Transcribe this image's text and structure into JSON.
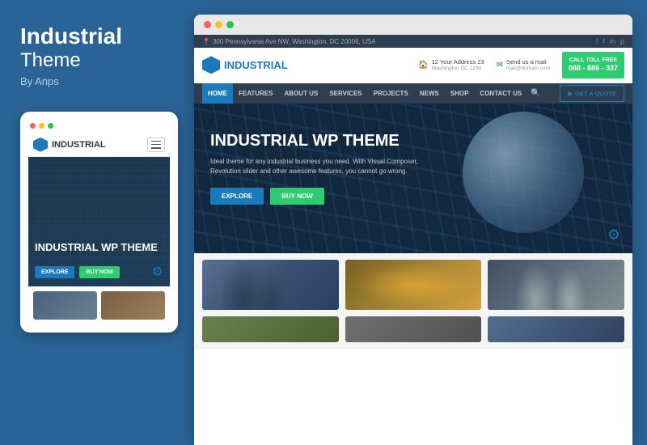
{
  "left": {
    "brand_title": "Industrial",
    "brand_sub": "Theme",
    "by_author": "By Anps"
  },
  "mobile": {
    "dots": [
      "red",
      "yellow",
      "green"
    ],
    "logo_text": "INDUSTRIAL",
    "hero_title": "INDUSTRIAL WP\nTHEME",
    "btn_explore": "EXPLORE",
    "btn_buynow": "BUY NOW"
  },
  "site": {
    "topbar_address": "300 Pennsylvania Ave NW, Washington, DC 20006, USA",
    "logo_text": "INDUSTRIAL",
    "address_label": "12 Your Address 23",
    "address_sub": "Washington DC 1234",
    "email_label": "Send us a mail",
    "email_val": "mail@domain.com",
    "call_label": "CALL TOLL FREE",
    "call_number": "088 - 886 - 337",
    "nav_items": [
      "HOME",
      "FEATURES",
      "ABOUT US",
      "SERVICES",
      "PROJECTS",
      "NEWS",
      "SHOP",
      "CONTACT US"
    ],
    "nav_active": "HOME",
    "nav_quote": "GET A QUOTE",
    "hero_title": "INDUSTRIAL WP THEME",
    "hero_desc": "Ideal theme for any industrial business you need. With Visual Composer, Revolution slider and other awesome features, you cannot go wrong.",
    "btn_explore": "EXPLORE",
    "btn_buy": "BUY NOW",
    "news_label": "NewS"
  },
  "colors": {
    "primary": "#1a7abb",
    "accent": "#2ecc71",
    "dark": "#2c3e50"
  }
}
